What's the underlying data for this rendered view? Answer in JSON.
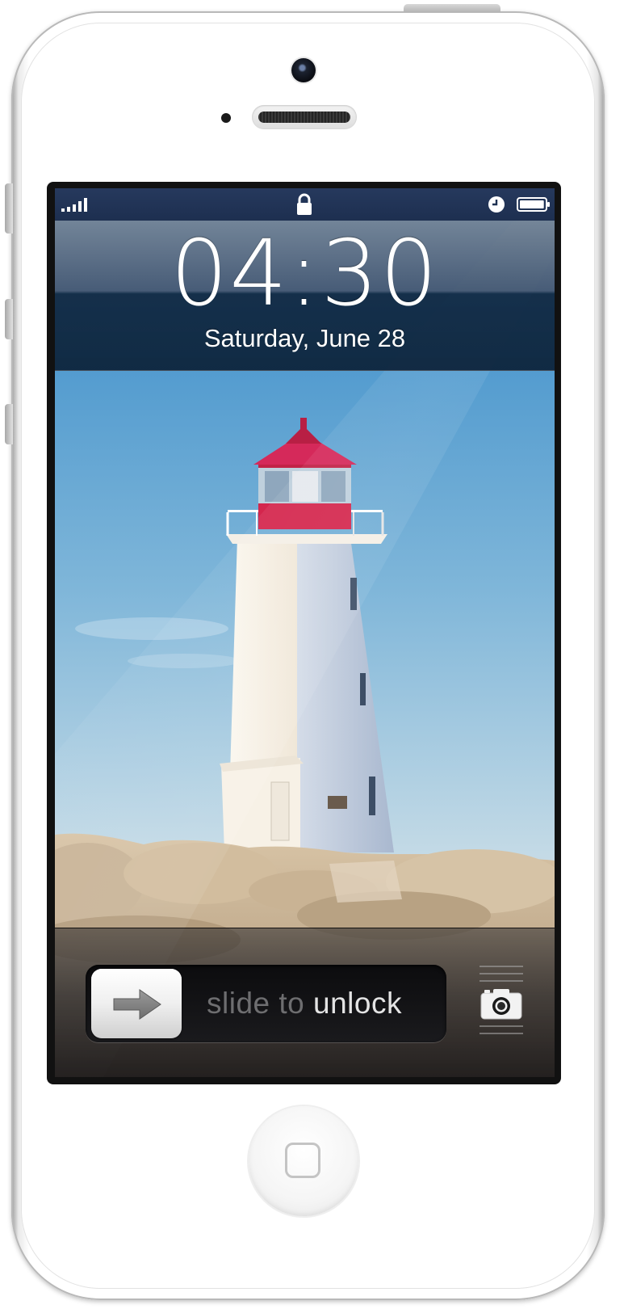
{
  "status_bar": {
    "signal_icon": "signal-bars-icon",
    "lock_icon": "padlock-icon",
    "alarm_icon": "clock-icon",
    "battery_icon": "battery-icon",
    "battery_level": 0.9
  },
  "lock_screen": {
    "time": "04:30",
    "date": "Saturday, June 28"
  },
  "wallpaper": {
    "subject": "lighthouse",
    "colors": {
      "sky_top": "#3a8fcb",
      "sky_bottom": "#dfe6ea",
      "lantern": "#d22a4f",
      "rock": "#cbb69a"
    }
  },
  "unlock": {
    "label_prefix": "slide to ",
    "label_highlight": "unlock",
    "knob_icon": "arrow-right-icon",
    "camera_icon": "camera-icon"
  },
  "hardware": {
    "home_button_icon": "home-square-icon",
    "front_camera": "front-camera-lens",
    "speaker": "earpiece-speaker"
  }
}
